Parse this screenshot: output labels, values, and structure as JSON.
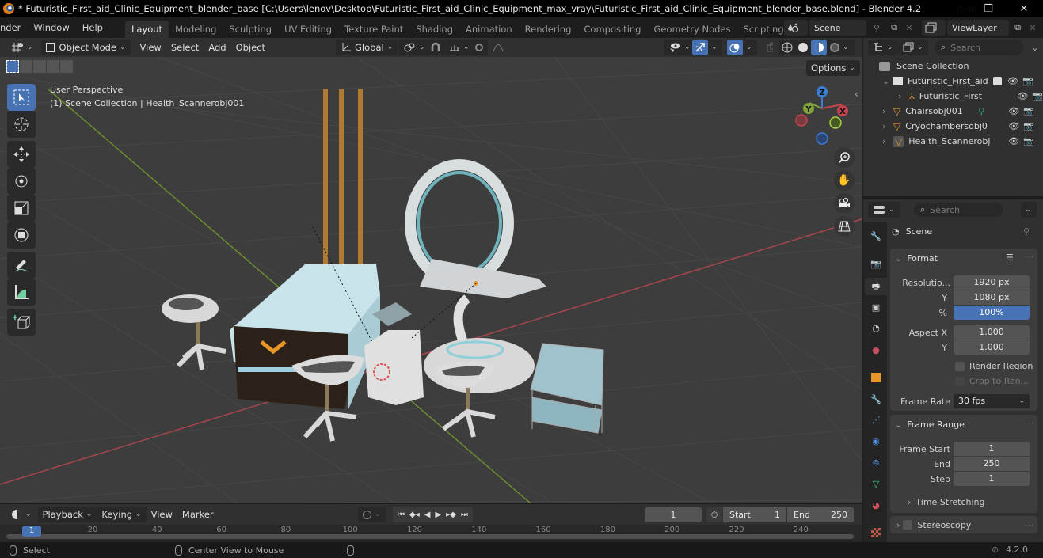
{
  "window": {
    "title": "* Futuristic_First_aid_Clinic_Equipment_blender_base [C:\\Users\\lenov\\Desktop\\Futuristic_First_aid_Clinic_Equipment_max_vray\\Futuristic_First_aid_Clinic_Equipment_blender_base.blend] - Blender 4.2",
    "minimize": "—",
    "maximize": "❐",
    "close": "✕"
  },
  "menu": [
    "nder",
    "Window",
    "Help"
  ],
  "workspaces": [
    "Layout",
    "Modeling",
    "Sculpting",
    "UV Editing",
    "Texture Paint",
    "Shading",
    "Animation",
    "Rendering",
    "Compositing",
    "Geometry Nodes",
    "Scripting"
  ],
  "workspace_add": "+",
  "scene_selector": {
    "value": "Scene"
  },
  "viewlayer_selector": {
    "value": "ViewLayer"
  },
  "viewport_header": {
    "mode": "Object Mode",
    "menus": [
      "View",
      "Select",
      "Add",
      "Object"
    ],
    "orientation": "Global",
    "options": "Options"
  },
  "viewport": {
    "perspective": "User Perspective",
    "collection_info": "(1) Scene Collection | Health_Scannerobj001",
    "gizmo": {
      "x": "X",
      "y": "Y",
      "z": "Z"
    },
    "colors": {
      "x_axis": "#c4434e",
      "y_axis": "#7fa33a",
      "z_axis": "#3b7ed8",
      "grid_bg": "#3d3d3d"
    }
  },
  "tools": [
    "select-box",
    "cursor",
    "move",
    "rotate",
    "scale",
    "transform",
    "annotate",
    "measure",
    "add-cube"
  ],
  "outliner": {
    "search_placeholder": "Search",
    "root": "Scene Collection",
    "items": [
      {
        "name": "Futuristic_First_aid",
        "type": "collection"
      },
      {
        "name": "Futuristic_First",
        "type": "armature"
      },
      {
        "name": "Chairsobj001",
        "type": "mesh"
      },
      {
        "name": "Cryochambersobj0",
        "type": "mesh"
      },
      {
        "name": "Health_Scannerobj",
        "type": "mesh"
      }
    ]
  },
  "properties": {
    "search_placeholder": "Search",
    "context": "Scene",
    "format": {
      "title": "Format",
      "resolution_label": "Resolutio...",
      "resolution_x": "1920 px",
      "y_label": "Y",
      "resolution_y": "1080 px",
      "percent_label": "%",
      "percent": "100%",
      "aspect_x_label": "Aspect X",
      "aspect_x": "1.000",
      "aspect_y_label": "Y",
      "aspect_y": "1.000",
      "render_region": "Render Region",
      "crop": "Crop to Ren...",
      "frame_rate_label": "Frame Rate",
      "frame_rate": "30 fps"
    },
    "frame_range": {
      "title": "Frame Range",
      "start_label": "Frame Start",
      "start": "1",
      "end_label": "End",
      "end": "250",
      "step_label": "Step",
      "step": "1",
      "time_stretching": "Time Stretching"
    },
    "stereoscopy": "Stereoscopy"
  },
  "timeline": {
    "menus": [
      "Playback",
      "Keying",
      "View",
      "Marker"
    ],
    "current_frame": "1",
    "start_label": "Start",
    "start": "1",
    "end_label": "End",
    "end": "250",
    "ruler": [
      "20",
      "40",
      "60",
      "80",
      "100",
      "120",
      "140",
      "160",
      "180",
      "200",
      "220",
      "240"
    ],
    "playhead": "1"
  },
  "statusbar": {
    "select": "Select",
    "center_view": "Center View to Mouse",
    "version": "4.2.0"
  }
}
